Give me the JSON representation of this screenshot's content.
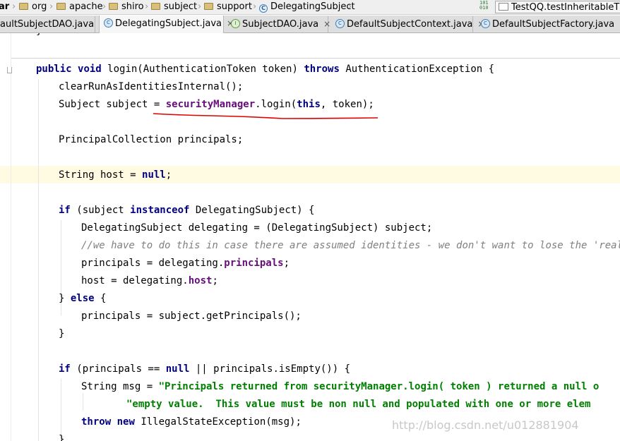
{
  "breadcrumb": {
    "items": [
      {
        "label": "ar",
        "icon": "jar-icon"
      },
      {
        "label": "org",
        "icon": "folder-icon"
      },
      {
        "label": "apache",
        "icon": "folder-icon"
      },
      {
        "label": "shiro",
        "icon": "folder-icon"
      },
      {
        "label": "subject",
        "icon": "folder-icon"
      },
      {
        "label": "support",
        "icon": "folder-icon"
      },
      {
        "label": "DelegatingSubject",
        "icon": "class-icon"
      }
    ],
    "vcs_icon": "vcs-update-icon",
    "vcs_icon_text": "101\n010",
    "run_config": "TestQQ.testInheritableThre"
  },
  "tabs": [
    {
      "label": "aultSubjectDAO.java",
      "close": "×",
      "icon": "none",
      "active": false
    },
    {
      "label": "DelegatingSubject.java",
      "close": "×",
      "icon": "class-icon",
      "icon_text": "C",
      "active": true
    },
    {
      "label": "SubjectDAO.java",
      "close": "×",
      "icon": "interface-icon",
      "icon_text": "I",
      "active": false
    },
    {
      "label": "DefaultSubjectContext.java",
      "close": "×",
      "icon": "class-icon",
      "icon_text": "C",
      "active": false
    },
    {
      "label": "DefaultSubjectFactory.java",
      "close": "×",
      "icon": "class-icon",
      "icon_text": "C",
      "active": false
    }
  ],
  "editor": {
    "caret_line_color": "#fffbe3",
    "keyword_color": "#000080",
    "field_color": "#660e7a",
    "string_color": "#008000",
    "comment_color": "#808080",
    "underline_color": "#e00000",
    "lines": [
      {
        "tokens": [
          {
            "t": "}",
            "c": ""
          }
        ]
      },
      {
        "tokens": [
          {
            "t": "public",
            "c": "kw"
          },
          {
            "t": " ",
            "c": ""
          },
          {
            "t": "void",
            "c": "kw"
          },
          {
            "t": " login(AuthenticationToken token) ",
            "c": ""
          },
          {
            "t": "throws",
            "c": "kw"
          },
          {
            "t": " AuthenticationException {",
            "c": ""
          }
        ]
      },
      {
        "tokens": [
          {
            "t": "clearRunAsIdentitiesInternal();",
            "c": ""
          }
        ]
      },
      {
        "tokens": [
          {
            "t": "Subject subject = ",
            "c": ""
          },
          {
            "t": "securityManager",
            "c": "fld"
          },
          {
            "t": ".login(",
            "c": ""
          },
          {
            "t": "this",
            "c": "kw"
          },
          {
            "t": ", token);",
            "c": ""
          }
        ]
      },
      {
        "tokens": [
          {
            "t": "PrincipalCollection principals;",
            "c": ""
          }
        ]
      },
      {
        "tokens": [
          {
            "t": "String host = ",
            "c": ""
          },
          {
            "t": "null",
            "c": "kw"
          },
          {
            "t": ";",
            "c": ""
          }
        ]
      },
      {
        "tokens": [
          {
            "t": "if",
            "c": "kw"
          },
          {
            "t": " (subject ",
            "c": ""
          },
          {
            "t": "instanceof",
            "c": "kw"
          },
          {
            "t": " DelegatingSubject) {",
            "c": ""
          }
        ]
      },
      {
        "tokens": [
          {
            "t": "DelegatingSubject delegating = (DelegatingSubject) subject;",
            "c": ""
          }
        ]
      },
      {
        "tokens": [
          {
            "t": "//we have to do this in case there are assumed identities - we don't want to lose the 'real' pri",
            "c": "cm"
          }
        ]
      },
      {
        "tokens": [
          {
            "t": "principals = delegating.",
            "c": ""
          },
          {
            "t": "principals",
            "c": "fld"
          },
          {
            "t": ";",
            "c": ""
          }
        ]
      },
      {
        "tokens": [
          {
            "t": "host = delegating.",
            "c": ""
          },
          {
            "t": "host",
            "c": "fld"
          },
          {
            "t": ";",
            "c": ""
          }
        ]
      },
      {
        "tokens": [
          {
            "t": "} ",
            "c": ""
          },
          {
            "t": "else",
            "c": "kw"
          },
          {
            "t": " {",
            "c": ""
          }
        ]
      },
      {
        "tokens": [
          {
            "t": "principals = subject.getPrincipals();",
            "c": ""
          }
        ]
      },
      {
        "tokens": [
          {
            "t": "}",
            "c": ""
          }
        ]
      },
      {
        "tokens": [
          {
            "t": "if",
            "c": "kw"
          },
          {
            "t": " (principals == ",
            "c": ""
          },
          {
            "t": "null",
            "c": "kw"
          },
          {
            "t": " || principals.isEmpty()) {",
            "c": ""
          }
        ]
      },
      {
        "tokens": [
          {
            "t": "String msg = ",
            "c": ""
          },
          {
            "t": "\"Principals returned from securityManager.login( token ) returned a null o",
            "c": "str"
          }
        ]
      },
      {
        "tokens": [
          {
            "t": "\"empty value.  This value must be non null and populated with one or more elem",
            "c": "str"
          }
        ]
      },
      {
        "tokens": [
          {
            "t": "throw",
            "c": "kw"
          },
          {
            "t": " ",
            "c": ""
          },
          {
            "t": "new",
            "c": "kw"
          },
          {
            "t": " IllegalStateException(msg);",
            "c": ""
          }
        ]
      },
      {
        "tokens": [
          {
            "t": "}",
            "c": ""
          }
        ]
      }
    ]
  },
  "watermark": "http://blog.csdn.net/u012881904"
}
